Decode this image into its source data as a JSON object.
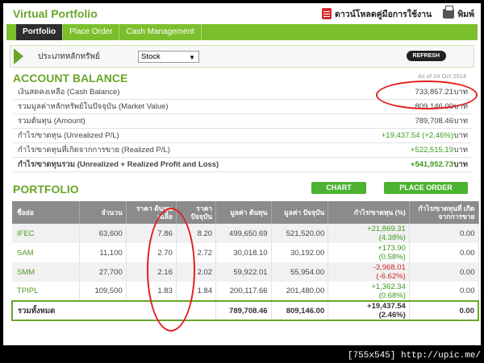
{
  "header": {
    "title": "Virtual Portfolio",
    "download_manual": "ดาวน์โหลดคู่มือการใช้งาน",
    "print": "พิมพ์"
  },
  "tabs": [
    "Portfolio",
    "Place Order",
    "Cash Management"
  ],
  "filter": {
    "label": "ประเภทหลักทรัพย์",
    "value": "Stock",
    "refresh": "REFRESH"
  },
  "account": {
    "title": "ACCOUNT BALANCE",
    "as_of": "As of 24 Oct 2014",
    "rows": [
      {
        "label": "เงินสดคงเหลือ (Cash Balance)",
        "value": "733,857.21",
        "unit": "บาท"
      },
      {
        "label": "รวมมูลค่าหลักทรัพย์ในปัจจุบัน (Market Value)",
        "value": "809,146.00",
        "unit": "บาท"
      },
      {
        "label": "รวมต้นทุน (Amount)",
        "value": "789,708.46",
        "unit": "บาท"
      },
      {
        "label": "กำไร/ขาดทุน (Unrealized P/L)",
        "value": "+19,437.54 (+2.46%)",
        "unit": "บาท"
      },
      {
        "label": "กำไร/ขาดทุนที่เกิดจากการขาย (Realized P/L)",
        "value": "+522,515.19",
        "unit": "บาท"
      },
      {
        "label": "กำไร/ขาดทุนรวม (Unrealized + Realized Profit and Loss)",
        "value": "+541,952.73",
        "unit": "บาท"
      }
    ]
  },
  "portfolio": {
    "title": "PORTFOLIO",
    "chart_button": "CHART",
    "order_button": "PLACE ORDER",
    "columns": [
      "ชื่อย่อ",
      "จำนวน",
      "ราคา ต้นทุนเฉลี่ย",
      "ราคา ปัจจุบัน",
      "มูลค่า ต้นทุน",
      "มูลค่า ปัจจุบัน",
      "กำไร/ขาดทุน (%)",
      "กำไร/ขาดทุนที่ เกิดจากการขาย"
    ],
    "rows": [
      {
        "symbol": "IFEC",
        "qty": "63,600",
        "avg": "7.86",
        "price": "8.20",
        "cost": "499,650.69",
        "value": "521,520.00",
        "pl": "+21,869.31",
        "pl_pct": "(4.38%)",
        "realized": "0.00"
      },
      {
        "symbol": "SAM",
        "qty": "11,100",
        "avg": "2.70",
        "price": "2.72",
        "cost": "30,018.10",
        "value": "30,192.00",
        "pl": "+173.90",
        "pl_pct": "(0.58%)",
        "realized": "0.00"
      },
      {
        "symbol": "SMM",
        "qty": "27,700",
        "avg": "2.16",
        "price": "2.02",
        "cost": "59,922.01",
        "value": "55,954.00",
        "pl": "-3,968.01",
        "pl_pct": "(-6.62%)",
        "realized": "0.00"
      },
      {
        "symbol": "TPIPL",
        "qty": "109,500",
        "avg": "1.83",
        "price": "1.84",
        "cost": "200,117.66",
        "value": "201,480.00",
        "pl": "+1,362.34",
        "pl_pct": "(0.68%)",
        "realized": "0.00"
      }
    ],
    "total": {
      "label": "รวมทั้งหมด",
      "cost": "789,708.46",
      "value": "809,146.00",
      "pl": "+19,437.54",
      "pl_pct": "(2.46%)",
      "realized": "0.00"
    }
  },
  "watermark": "[755x545] http://upic.me/",
  "colors": {
    "accent": "#6aa52a",
    "positive": "#3c9a1a",
    "negative": "#cc2222",
    "annotation": "#e41e1e"
  }
}
